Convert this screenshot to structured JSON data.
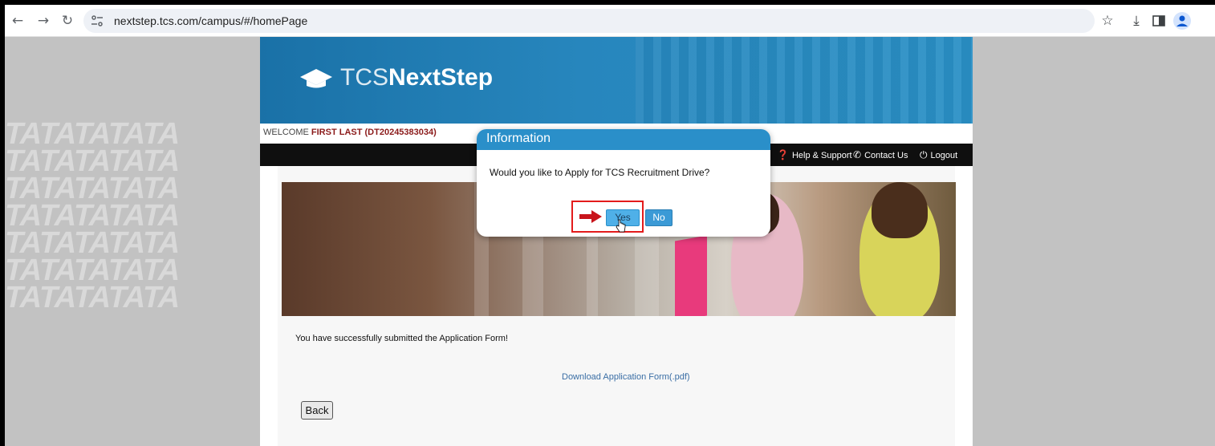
{
  "browser": {
    "url": "nextstep.tcs.com/campus/#/homePage",
    "icons": [
      "back-icon",
      "forward-icon",
      "reload-icon",
      "site-settings-icon",
      "bookmark-star-icon",
      "download-icon",
      "side-panel-icon",
      "profile-icon"
    ]
  },
  "site": {
    "logo_light": "TCS",
    "logo_bold": "NextStep",
    "welcome_prefix": "WELCOME ",
    "welcome_name": "FIRST LAST (DT20245383034)",
    "nav": {
      "help": "Help & Support",
      "contact": "Contact Us",
      "logout": "Logout"
    },
    "background_text": "TATATATATA",
    "success_message": "You have successfully submitted the Application Form!",
    "download_link": "Download Application Form(.pdf)",
    "back_label": "Back"
  },
  "dialog": {
    "title": "Information",
    "message": "Would you like to Apply for TCS Recruitment Drive?",
    "yes_label": "Yes",
    "no_label": "No"
  },
  "colors": {
    "banner_blue": "#2786bd",
    "dialog_header": "#2a8fc9",
    "highlight_red": "#e31b1b",
    "welcome_name": "#8b1a1a"
  }
}
